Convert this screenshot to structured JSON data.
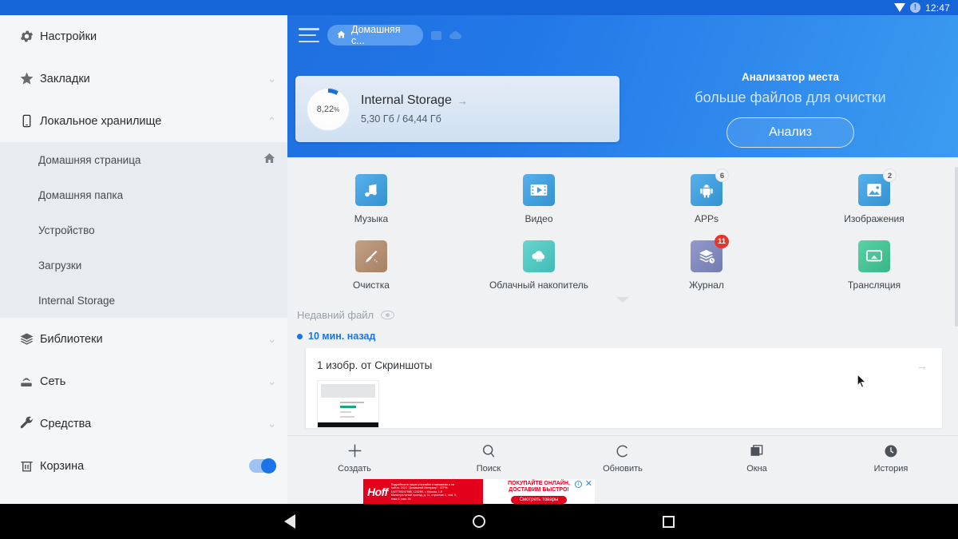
{
  "statusbar": {
    "time": "12:47",
    "wifi_icon": "wifi-icon",
    "alert_icon": "alert-icon",
    "alert_glyph": "!"
  },
  "sidebar": {
    "items": [
      {
        "label": "Настройки",
        "icon": "gear-icon",
        "chevron": "",
        "name": "settings"
      },
      {
        "label": "Закладки",
        "icon": "star-icon",
        "chevron": "⌄",
        "name": "bookmarks"
      },
      {
        "label": "Локальное хранилище",
        "icon": "phone-icon",
        "chevron": "⌃",
        "name": "local-storage"
      }
    ],
    "sub_items": [
      {
        "label": "Домашняя страница",
        "trailing_icon": "home-icon",
        "name": "home-page"
      },
      {
        "label": "Домашняя папка",
        "trailing_icon": "",
        "name": "home-folder"
      },
      {
        "label": "Устройство",
        "trailing_icon": "",
        "name": "device"
      },
      {
        "label": "Загрузки",
        "trailing_icon": "",
        "name": "downloads"
      },
      {
        "label": "Internal Storage",
        "trailing_icon": "",
        "name": "internal-storage"
      }
    ],
    "items_bottom": [
      {
        "label": "Библиотеки",
        "icon": "layers-icon",
        "chevron": "⌄",
        "name": "libraries"
      },
      {
        "label": "Сеть",
        "icon": "network-icon",
        "chevron": "⌄",
        "name": "network"
      },
      {
        "label": "Средства",
        "icon": "wrench-icon",
        "chevron": "⌄",
        "name": "tools"
      }
    ],
    "trash": {
      "label": "Корзина",
      "icon": "trash-icon",
      "toggle_on": true,
      "name": "trash"
    }
  },
  "toolbar": {
    "menu_icon": "hamburger-icon",
    "tab_label": "Домашняя с...",
    "tab_icon": "home-icon",
    "icon2": "window-icon",
    "icon3": "cloud-icon"
  },
  "storage_card": {
    "percent_value": "8,22",
    "percent_unit": "%",
    "percent_number": 8.22,
    "title": "Internal Storage",
    "arrow": "→",
    "usage": "5,30 Гб / 64,44 Гб"
  },
  "analyzer": {
    "title": "Анализатор места",
    "subtitle": "больше файлов для очистки",
    "button": "Анализ"
  },
  "grid": {
    "row1": [
      {
        "caption": "Музыка",
        "icon": "music-icon",
        "color": "#3aa3e8",
        "badge": "",
        "badge_kind": ""
      },
      {
        "caption": "Видео",
        "icon": "video-icon",
        "color": "#3aa3e8",
        "badge": "",
        "badge_kind": ""
      },
      {
        "caption": "APPs",
        "icon": "android-icon",
        "color": "#3aa3e8",
        "badge": "6",
        "badge_kind": "gray"
      },
      {
        "caption": "Изображения",
        "icon": "image-icon",
        "color": "#3aa3e8",
        "badge": "2",
        "badge_kind": "gray"
      }
    ],
    "row2": [
      {
        "caption": "Очистка",
        "icon": "broom-icon",
        "color": "#b98f6f",
        "badge": "",
        "badge_kind": ""
      },
      {
        "caption": "Облачный накопитель",
        "icon": "cloud-icon",
        "color": "#4ccfc8",
        "badge": "",
        "badge_kind": ""
      },
      {
        "caption": "Журнал",
        "icon": "history-stack-icon",
        "color": "#8189c4",
        "badge": "11",
        "badge_kind": "red"
      },
      {
        "caption": "Трансляция",
        "icon": "cast-icon",
        "color": "#3ecb96",
        "badge": "",
        "badge_kind": ""
      }
    ],
    "collapse_icon": "chevron-down-icon"
  },
  "recent": {
    "header": "Недавний файл",
    "eye_icon": "eye-icon",
    "timestamp": "10 мин. назад",
    "card_title": "1 изобр. от Скриншоты",
    "card_arrow": "→"
  },
  "bottombar": [
    {
      "label": "Создать",
      "icon": "plus-icon",
      "name": "create"
    },
    {
      "label": "Поиск",
      "icon": "search-icon",
      "name": "search"
    },
    {
      "label": "Обновить",
      "icon": "refresh-icon",
      "name": "refresh"
    },
    {
      "label": "Окна",
      "icon": "windows-icon",
      "name": "windows"
    },
    {
      "label": "История",
      "icon": "clock-icon",
      "name": "history"
    }
  ],
  "ad": {
    "logo": "Hoff",
    "fine_print": "Подробности акции уточняйте в магазинах и на hoff.ru. ООО \"Домашний Интерьер\", ОГРН: 1027700247985, 123290, г. Москва, 1-й Магистральный проезд, д. 11, строение 1, пом. II, этаж 2, ком. 54",
    "headline_1": "ПОКУПАЙТЕ ОНЛАЙН,",
    "headline_2": "ДОСТАВИМ БЫСТРО!",
    "cta": "Смотреть товары",
    "info_glyph": "i",
    "close_glyph": "✕"
  },
  "androidnav": {
    "back": "back-icon",
    "home": "home-icon",
    "recents": "recents-icon"
  },
  "colors": {
    "accent": "#1a73e8",
    "hero_from": "#1f6fe0",
    "hero_to": "#3b9bf0",
    "badge_red": "#e8352b"
  }
}
